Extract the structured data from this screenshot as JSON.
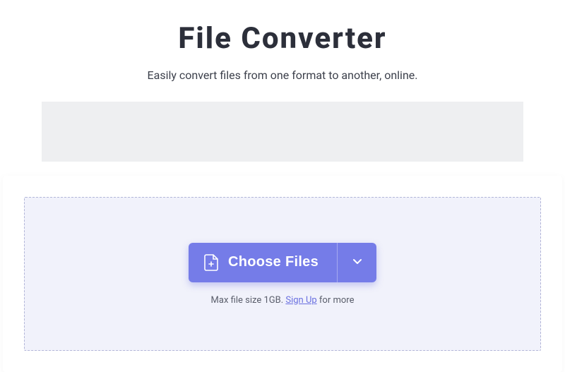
{
  "header": {
    "title": "File Converter",
    "subtitle": "Easily convert files from one format to another, online."
  },
  "upload": {
    "choose_label": "Choose Files",
    "hint_prefix": "Max file size 1GB. ",
    "signup_label": "Sign Up",
    "hint_suffix": " for more"
  },
  "colors": {
    "accent": "#757ce8",
    "text_dark": "#2c2f3a",
    "dropzone_bg": "#f1f2fb",
    "dropzone_border": "#b3b6d8"
  }
}
